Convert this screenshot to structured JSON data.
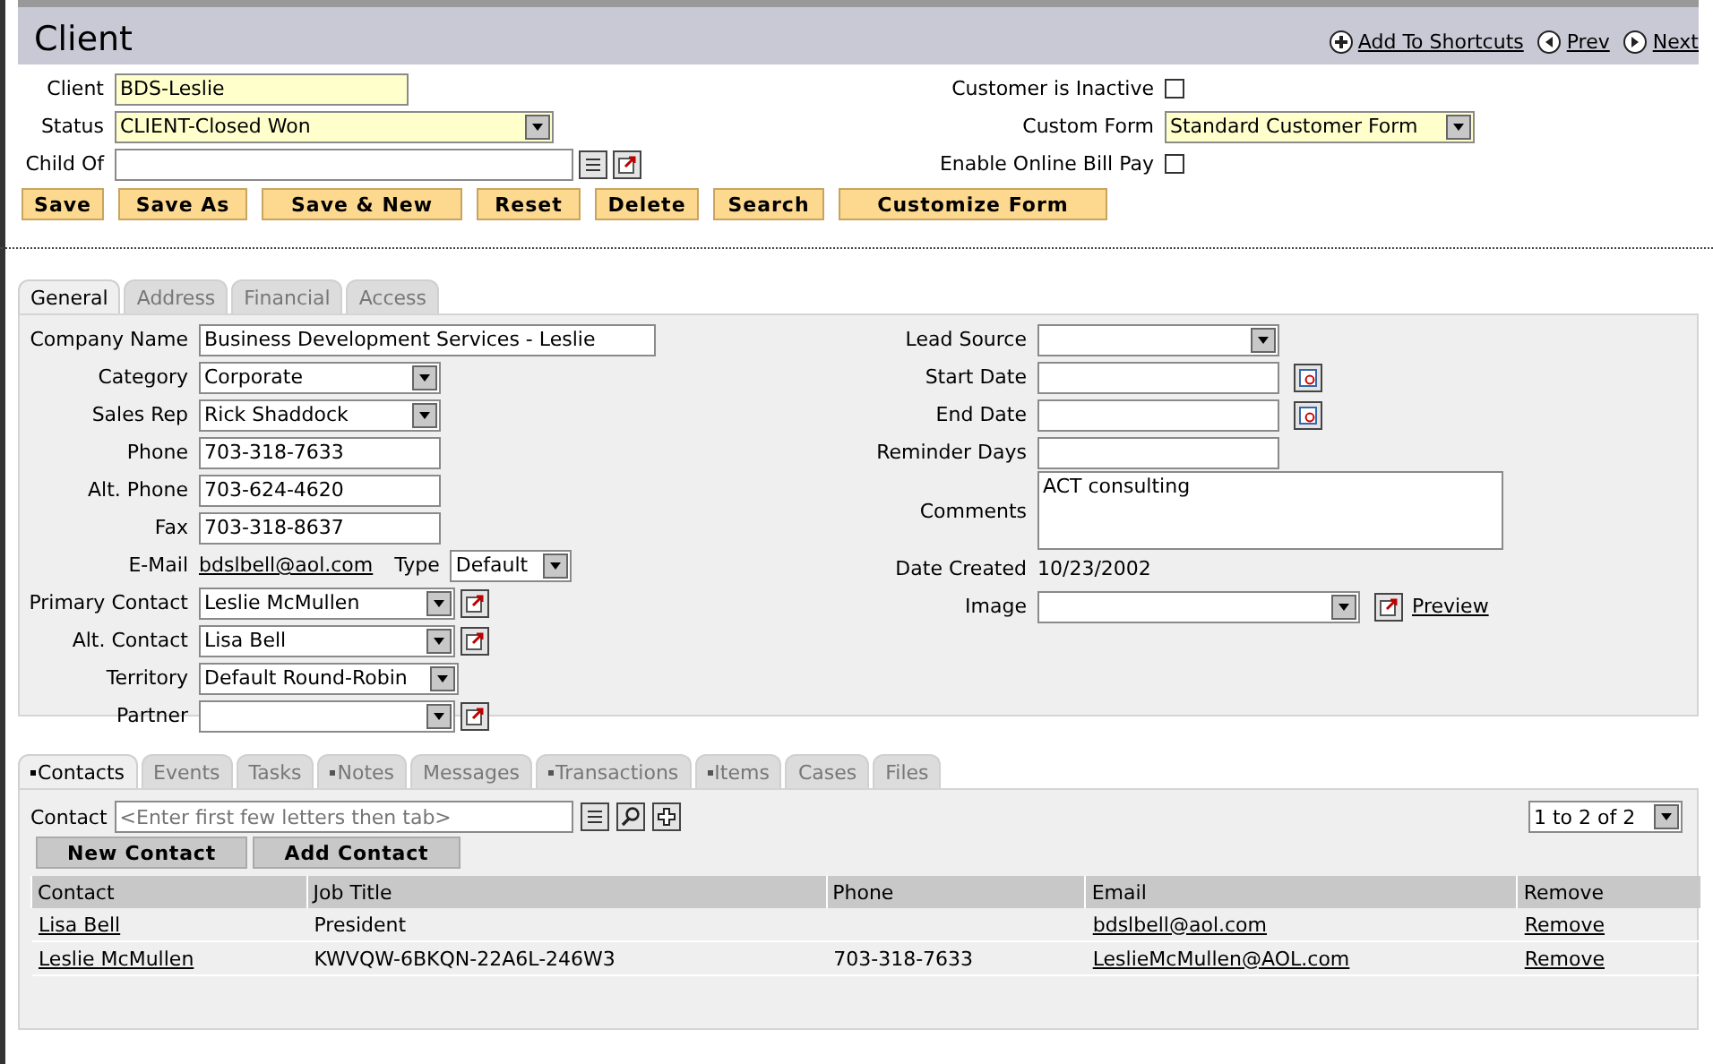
{
  "header": {
    "title": "Client",
    "links": [
      {
        "label": "Add To Shortcuts",
        "kind": "add"
      },
      {
        "label": "Prev",
        "kind": "prev"
      },
      {
        "label": "Next",
        "kind": "next"
      }
    ]
  },
  "main_left": [
    {
      "label": "Client",
      "kind": "text",
      "value": "BDS-Leslie",
      "mandatory": true
    },
    {
      "label": "Status",
      "kind": "select",
      "value": "CLIENT-Closed Won",
      "mandatory": true
    },
    {
      "label": "Child Of",
      "kind": "lookup",
      "mandatory": false
    }
  ],
  "main_right": [
    {
      "label": "Customer is Inactive",
      "kind": "checkbox",
      "checked": false
    },
    {
      "label": "Custom Form",
      "kind": "select",
      "value": "Standard Customer Form",
      "mandatory": true
    },
    {
      "label": "Enable Online Bill Pay",
      "kind": "checkbox",
      "checked": false
    }
  ],
  "buttons": [
    "Save",
    "Save As",
    "Save & New",
    "Reset",
    "Delete",
    "Search",
    "Customize Form"
  ],
  "tabs": [
    {
      "label": "General",
      "selected": true
    },
    {
      "label": "Address",
      "selected": false
    },
    {
      "label": "Financial",
      "selected": false
    },
    {
      "label": "Access",
      "selected": false
    }
  ],
  "general_left": [
    {
      "label": "Company Name",
      "kind": "text",
      "value": "Business Development Services - Leslie",
      "mandatory": false
    },
    {
      "label": "Category",
      "kind": "select",
      "value": "Corporate",
      "mandatory": false
    },
    {
      "label": "Sales Rep",
      "kind": "select",
      "value": "Rick Shaddock",
      "mandatory": false
    },
    {
      "label": "Phone",
      "kind": "text",
      "value": "703-318-7633",
      "mandatory": false
    },
    {
      "label": "Alt. Phone",
      "kind": "text",
      "value": "703-624-4620",
      "mandatory": false
    },
    {
      "label": "Fax",
      "kind": "text",
      "value": "703-318-8637",
      "mandatory": false
    },
    {
      "label": "E-Mail",
      "kind": "email",
      "value": "bdslbell@aol.com",
      "type_label": "Type",
      "type_value": "Default"
    },
    {
      "label": "Primary Contact",
      "kind": "select-popup",
      "value": "Leslie McMullen",
      "mandatory": false
    },
    {
      "label": "Alt. Contact",
      "kind": "select-popup",
      "value": "Lisa Bell",
      "mandatory": false
    },
    {
      "label": "Territory",
      "kind": "select",
      "value": "Default Round-Robin",
      "mandatory": false
    },
    {
      "label": "Partner",
      "kind": "select-popup",
      "mandatory": false
    }
  ],
  "general_right": [
    {
      "label": "Lead Source",
      "kind": "select",
      "mandatory": false
    },
    {
      "label": "Start Date",
      "kind": "date",
      "mandatory": false
    },
    {
      "label": "End Date",
      "kind": "date",
      "mandatory": false
    },
    {
      "label": "Reminder Days",
      "kind": "text",
      "mandatory": false
    },
    {
      "label": "Comments",
      "kind": "textarea",
      "value": "ACT consulting",
      "mandatory": false
    },
    {
      "label": "Date Created",
      "kind": "static",
      "value": "10/23/2002"
    },
    {
      "label": "Image",
      "kind": "image",
      "link": "Preview",
      "mandatory": false
    }
  ],
  "subtabs": [
    {
      "label": "Contacts",
      "selected": true,
      "marked": true
    },
    {
      "label": "Events",
      "selected": false,
      "marked": false
    },
    {
      "label": "Tasks",
      "selected": false,
      "marked": false
    },
    {
      "label": "Notes",
      "selected": false,
      "marked": true
    },
    {
      "label": "Messages",
      "selected": false,
      "marked": false
    },
    {
      "label": "Transactions",
      "selected": false,
      "marked": true
    },
    {
      "label": "Items",
      "selected": false,
      "marked": true
    },
    {
      "label": "Cases",
      "selected": false,
      "marked": false
    },
    {
      "label": "Files",
      "selected": false,
      "marked": false
    }
  ],
  "sublist": {
    "contact_label": "Contact",
    "contact_placeholder": "<Enter first few letters then tab>",
    "pager": "1 to 2 of 2",
    "buttons": [
      "New Contact",
      "Add Contact"
    ],
    "columns": [
      "Contact",
      "Job Title",
      "Phone",
      "Email",
      "Remove"
    ],
    "rows": [
      {
        "contact": "Lisa Bell",
        "job_title": "President",
        "email": "bdslbell@aol.com",
        "remove": "Remove"
      },
      {
        "contact": "Leslie McMullen",
        "job_title": "KWVQW-6BKQN-22A6L-246W3",
        "phone": "703-318-7633",
        "email": "LeslieMcMullen@AOL.com",
        "remove": "Remove"
      }
    ]
  }
}
